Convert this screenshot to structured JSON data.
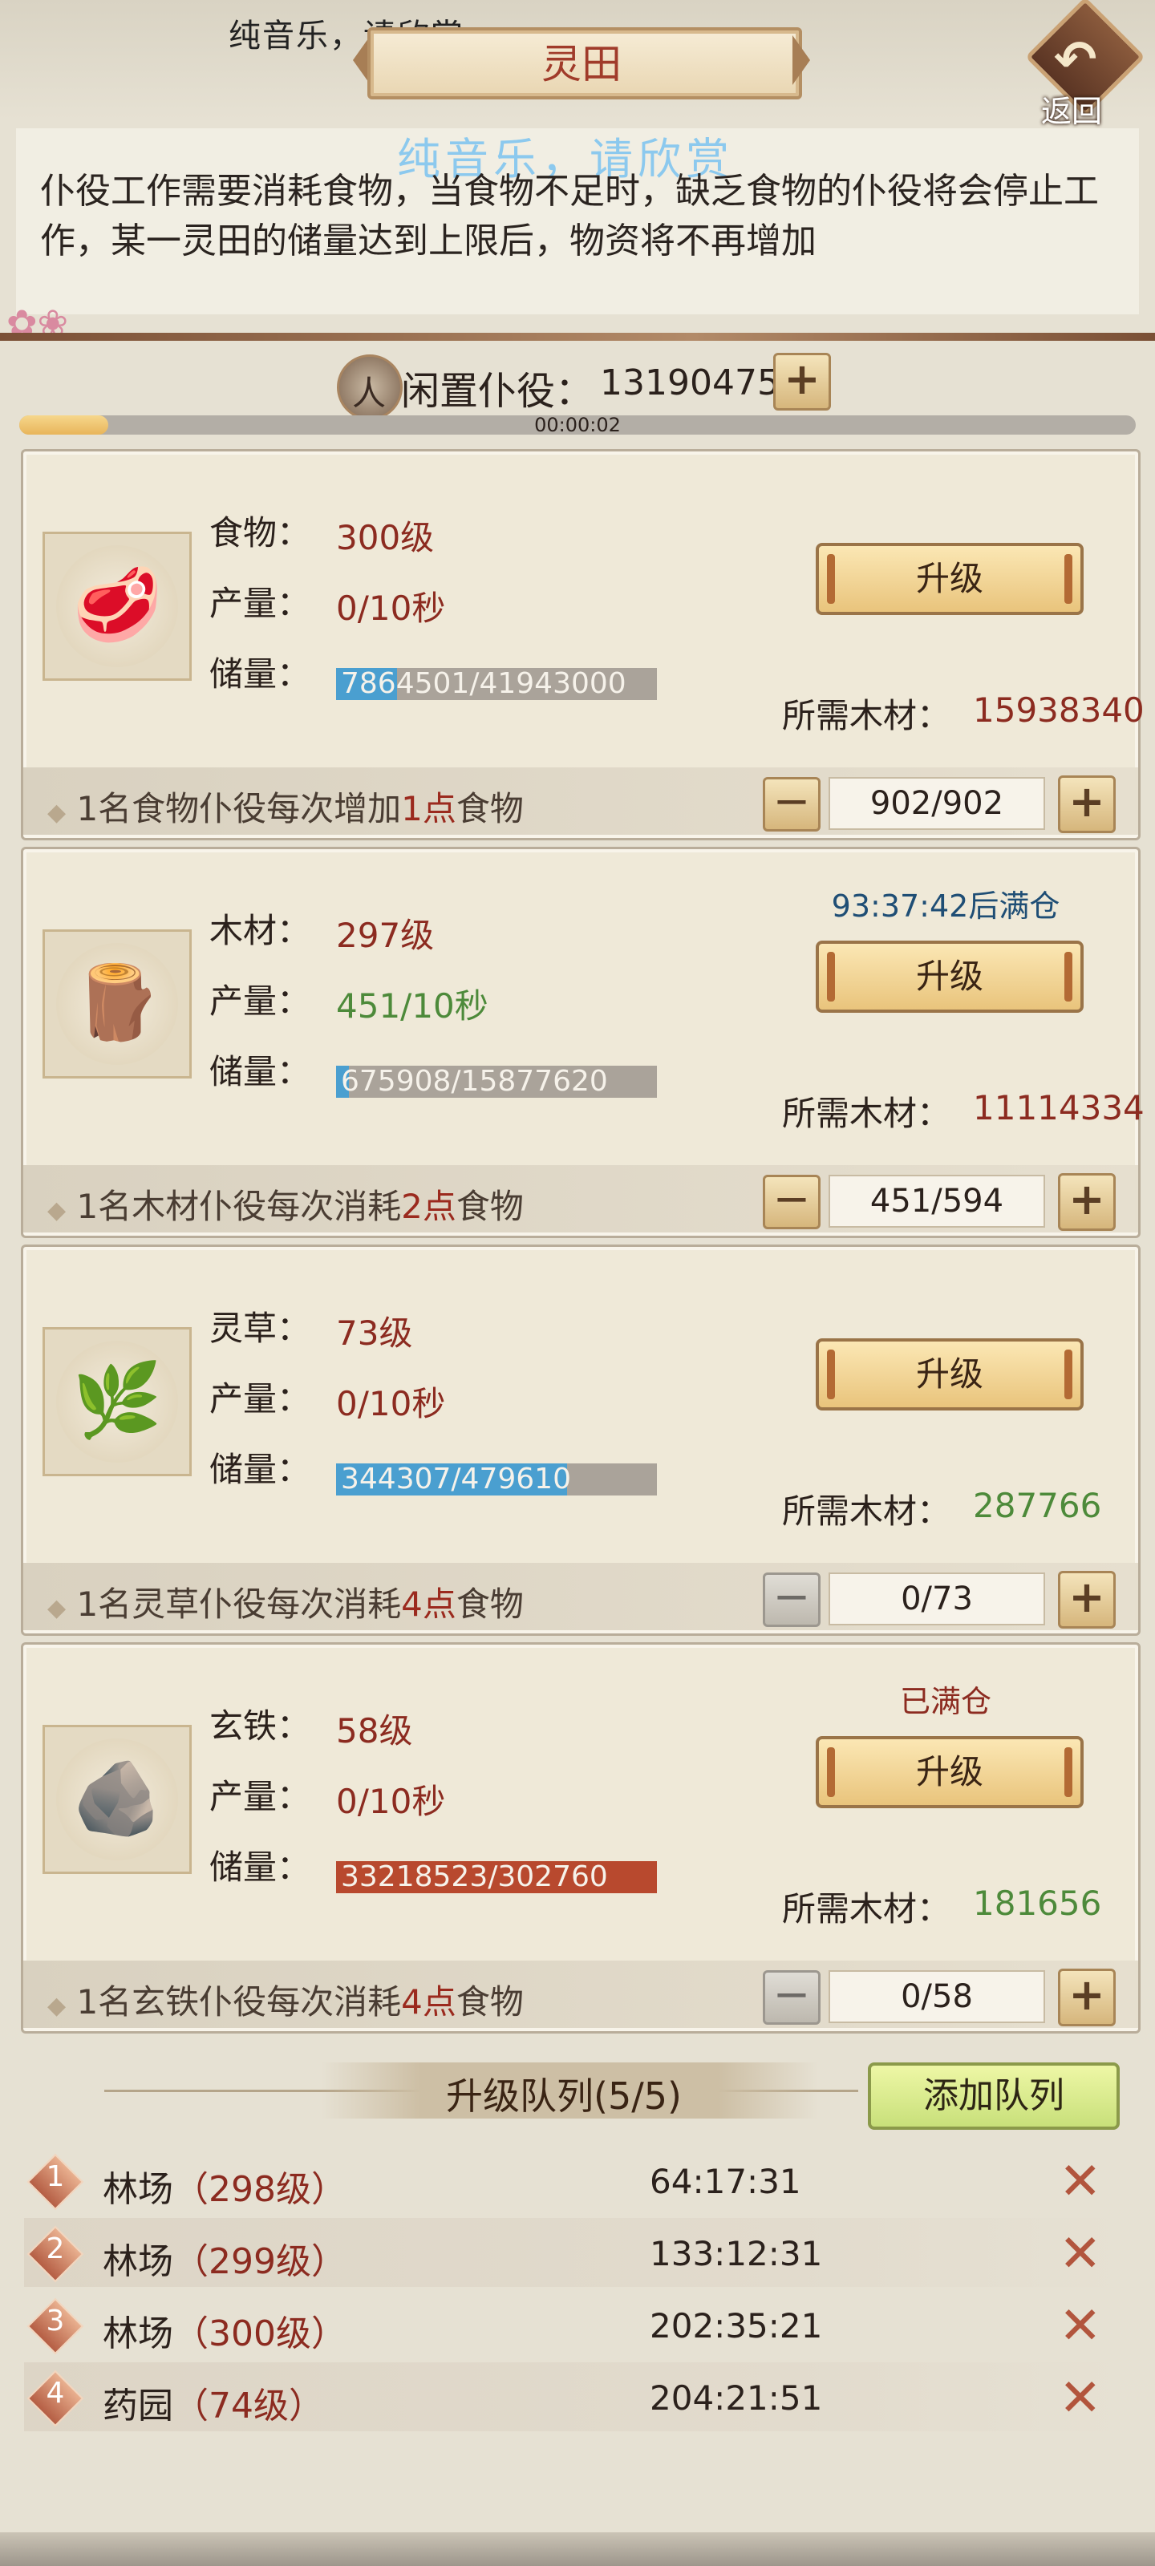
{
  "header": {
    "watermark_top": "纯音乐，请欣赏",
    "title": "灵田",
    "back_label": "返回",
    "watermark_mid": "纯音乐，请欣赏"
  },
  "description": "仆役工作需要消耗食物，当食物不足时，缺乏食物的仆役将会停止工作，某一灵田的储量达到上限后，物资将不再增加",
  "idle": {
    "label": "闲置仆役：",
    "value": "13190475",
    "progress_fraction": 0.08,
    "timer": "00:00:02"
  },
  "cards": [
    {
      "name_label": "食物：",
      "level": "300级",
      "rate_label": "产量：",
      "rate": "0/10秒",
      "rate_color": "#8c2b20",
      "storage_label": "储量：",
      "storage": "7864501/41943000",
      "storage_fraction": 0.19,
      "bar_color": "#4a9fd0",
      "status": "",
      "status_color": "#1f4e75",
      "upgrade_label": "升级",
      "cost_label": "所需木材：",
      "cost": "15938340",
      "cost_color": "#8c2b20",
      "strip": {
        "pre": "1名食物仆役每次增加",
        "num": "1点",
        "post": "食物"
      },
      "count": "902/902",
      "icon": "meat-icon",
      "minus_active": true
    },
    {
      "name_label": "木材：",
      "level": "297级",
      "rate_label": "产量：",
      "rate": "451/10秒",
      "rate_color": "#4d8a3a",
      "storage_label": "储量：",
      "storage": "675908/15877620",
      "storage_fraction": 0.04,
      "bar_color": "#4a9fd0",
      "status": "93:37:42后满仓",
      "status_color": "#1f4e75",
      "upgrade_label": "升级",
      "cost_label": "所需木材：",
      "cost": "11114334",
      "cost_color": "#8c2b20",
      "strip": {
        "pre": "1名木材仆役每次消耗",
        "num": "2点",
        "post": "食物"
      },
      "count": "451/594",
      "icon": "logs-icon",
      "minus_active": true
    },
    {
      "name_label": "灵草：",
      "level": "73级",
      "rate_label": "产量：",
      "rate": "0/10秒",
      "rate_color": "#8c2b20",
      "storage_label": "储量：",
      "storage": "344307/479610",
      "storage_fraction": 0.72,
      "bar_color": "#4a9fd0",
      "status": "",
      "status_color": "#1f4e75",
      "upgrade_label": "升级",
      "cost_label": "所需木材：",
      "cost": "287766",
      "cost_color": "#4d8a3a",
      "strip": {
        "pre": "1名灵草仆役每次消耗",
        "num": "4点",
        "post": "食物"
      },
      "count": "0/73",
      "icon": "herb-icon",
      "minus_active": false
    },
    {
      "name_label": "玄铁：",
      "level": "58级",
      "rate_label": "产量：",
      "rate": "0/10秒",
      "rate_color": "#8c2b20",
      "storage_label": "储量：",
      "storage": "33218523/302760",
      "storage_fraction": 1.0,
      "bar_color": "#b8492e",
      "status": "已满仓",
      "status_color": "#8c2b20",
      "upgrade_label": "升级",
      "cost_label": "所需木材：",
      "cost": "181656",
      "cost_color": "#4d8a3a",
      "strip": {
        "pre": "1名玄铁仆役每次消耗",
        "num": "4点",
        "post": "食物"
      },
      "count": "0/58",
      "icon": "iron-ore-icon",
      "minus_active": false
    }
  ],
  "queue": {
    "title": "升级队列(5/5)",
    "add_label": "添加队列",
    "items": [
      {
        "num": "1",
        "name": "林场",
        "level": "（298级）",
        "time": "64:17:31"
      },
      {
        "num": "2",
        "name": "林场",
        "level": "（299级）",
        "time": "133:12:31"
      },
      {
        "num": "3",
        "name": "林场",
        "level": "（300级）",
        "time": "202:35:21"
      },
      {
        "num": "4",
        "name": "药园",
        "level": "（74级）",
        "time": "204:21:51"
      }
    ]
  }
}
